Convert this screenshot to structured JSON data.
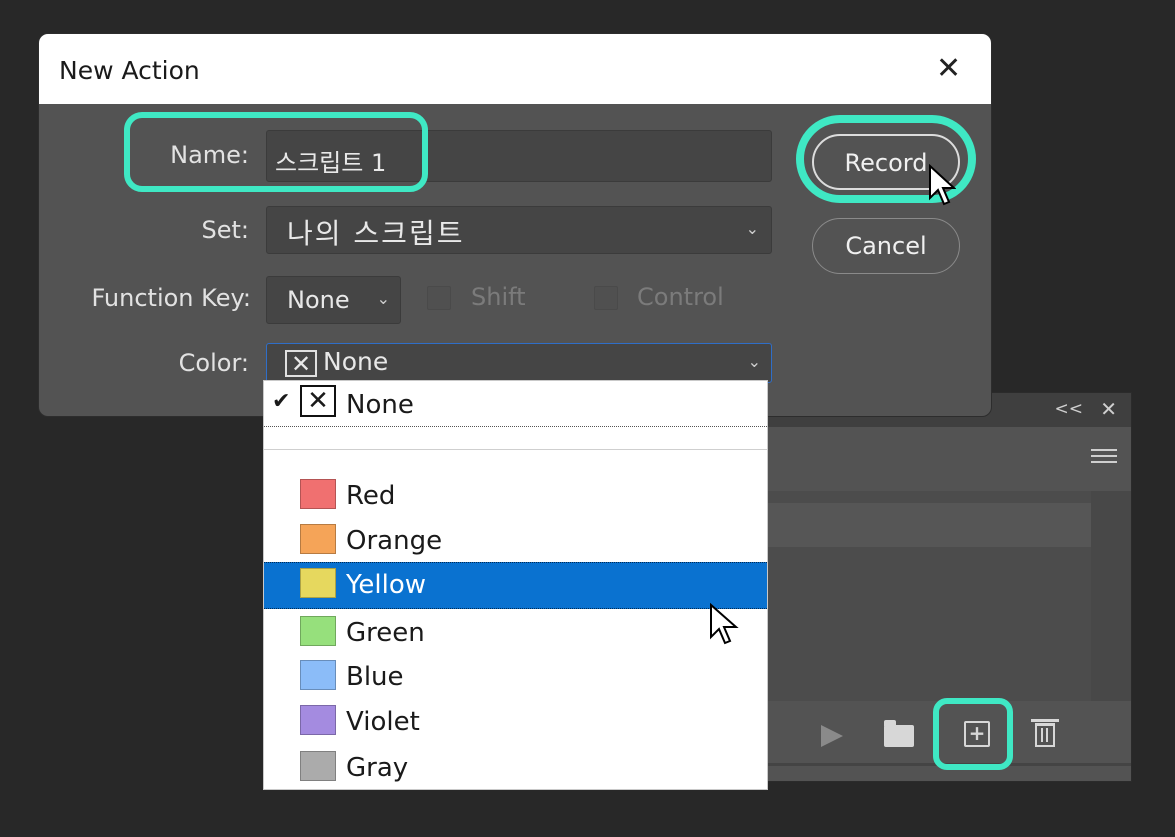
{
  "actions_panel": {
    "collapse_glyph": "<<",
    "close_glyph": "✕",
    "icons": [
      "play-icon",
      "folder-icon",
      "new-action-icon",
      "trash-icon",
      "panel-menu-icon"
    ]
  },
  "dialog": {
    "title": "New Action",
    "close_glyph": "✕",
    "name_label": "Name:",
    "name_value": "스크립트 1",
    "set_label": "Set:",
    "set_value": "나의 스크립트",
    "function_key_label": "Function Key:",
    "function_key_value": "None",
    "shift_label": "Shift",
    "control_label": "Control",
    "color_label": "Color:",
    "color_value": "None",
    "record_label": "Record",
    "cancel_label": "Cancel"
  },
  "color_dropdown": {
    "none_item": "None",
    "checkmark": "✔",
    "x_glyph": "✕",
    "items": [
      {
        "label": "Red",
        "color": "#f07070"
      },
      {
        "label": "Orange",
        "color": "#f5a458"
      },
      {
        "label": "Yellow",
        "color": "#e6d85e"
      },
      {
        "label": "Green",
        "color": "#96e07c"
      },
      {
        "label": "Blue",
        "color": "#8bbcf8"
      },
      {
        "label": "Violet",
        "color": "#a48be0"
      },
      {
        "label": "Gray",
        "color": "#ababab"
      }
    ],
    "selected": "Yellow"
  },
  "colors": {
    "highlight": "#3fe8c4",
    "selection": "#0a72d0"
  }
}
